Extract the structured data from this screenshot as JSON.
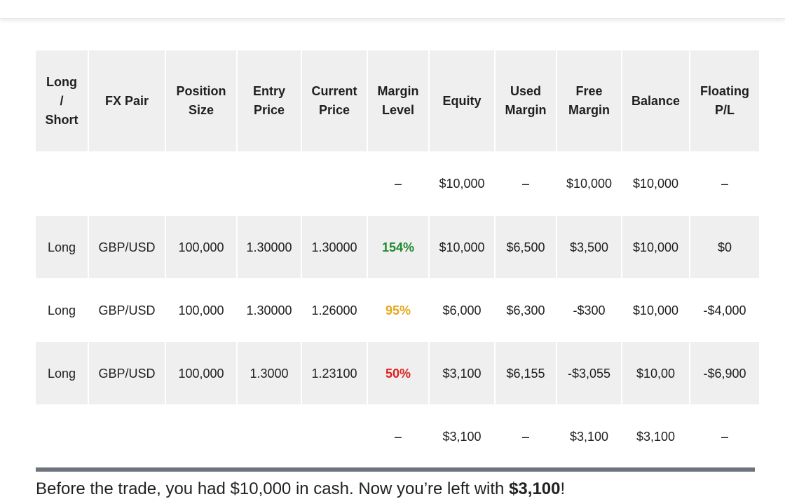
{
  "headers": [
    [
      "Long",
      "/",
      "Short"
    ],
    [
      "FX Pair"
    ],
    [
      "Position",
      "Size"
    ],
    [
      "Entry",
      "Price"
    ],
    [
      "Current",
      "Price"
    ],
    [
      "Margin",
      "Level"
    ],
    [
      "Equity"
    ],
    [
      "Used",
      "Margin"
    ],
    [
      "Free",
      "Margin"
    ],
    [
      "Balance"
    ],
    [
      "Floating",
      "P/L"
    ]
  ],
  "rows": [
    {
      "style": "plain",
      "cells": [
        "",
        "",
        "",
        "",
        "",
        "–",
        "$10,000",
        "–",
        "$10,000",
        "$10,000",
        "–"
      ],
      "margin_color": ""
    },
    {
      "style": "shade",
      "cells": [
        "Long",
        "GBP/USD",
        "100,000",
        "1.30000",
        "1.30000",
        "154%",
        "$10,000",
        "$6,500",
        "$3,500",
        "$10,000",
        "$0"
      ],
      "margin_color": "#1f8a2e"
    },
    {
      "style": "white",
      "cells": [
        "Long",
        "GBP/USD",
        "100,000",
        "1.30000",
        "1.26000",
        "95%",
        "$6,000",
        "$6,300",
        "-$300",
        "$10,000",
        "-$4,000"
      ],
      "margin_color": "#e6a81e"
    },
    {
      "style": "shade",
      "cells": [
        "Long",
        "GBP/USD",
        "100,000",
        "1.3000",
        "1.23100",
        "50%",
        "$3,100",
        "$6,155",
        "-$3,055",
        "$10,00",
        "-$6,900"
      ],
      "margin_color": "#e02020"
    },
    {
      "style": "plain",
      "cells": [
        "",
        "",
        "",
        "",
        "",
        "–",
        "$3,100",
        "–",
        "$3,100",
        "$3,100",
        "–"
      ],
      "margin_color": ""
    }
  ],
  "caption": {
    "text": "Before the trade, you had $10,000 in cash. Now you’re left with ",
    "bold": "$3,100",
    "end": "!"
  }
}
